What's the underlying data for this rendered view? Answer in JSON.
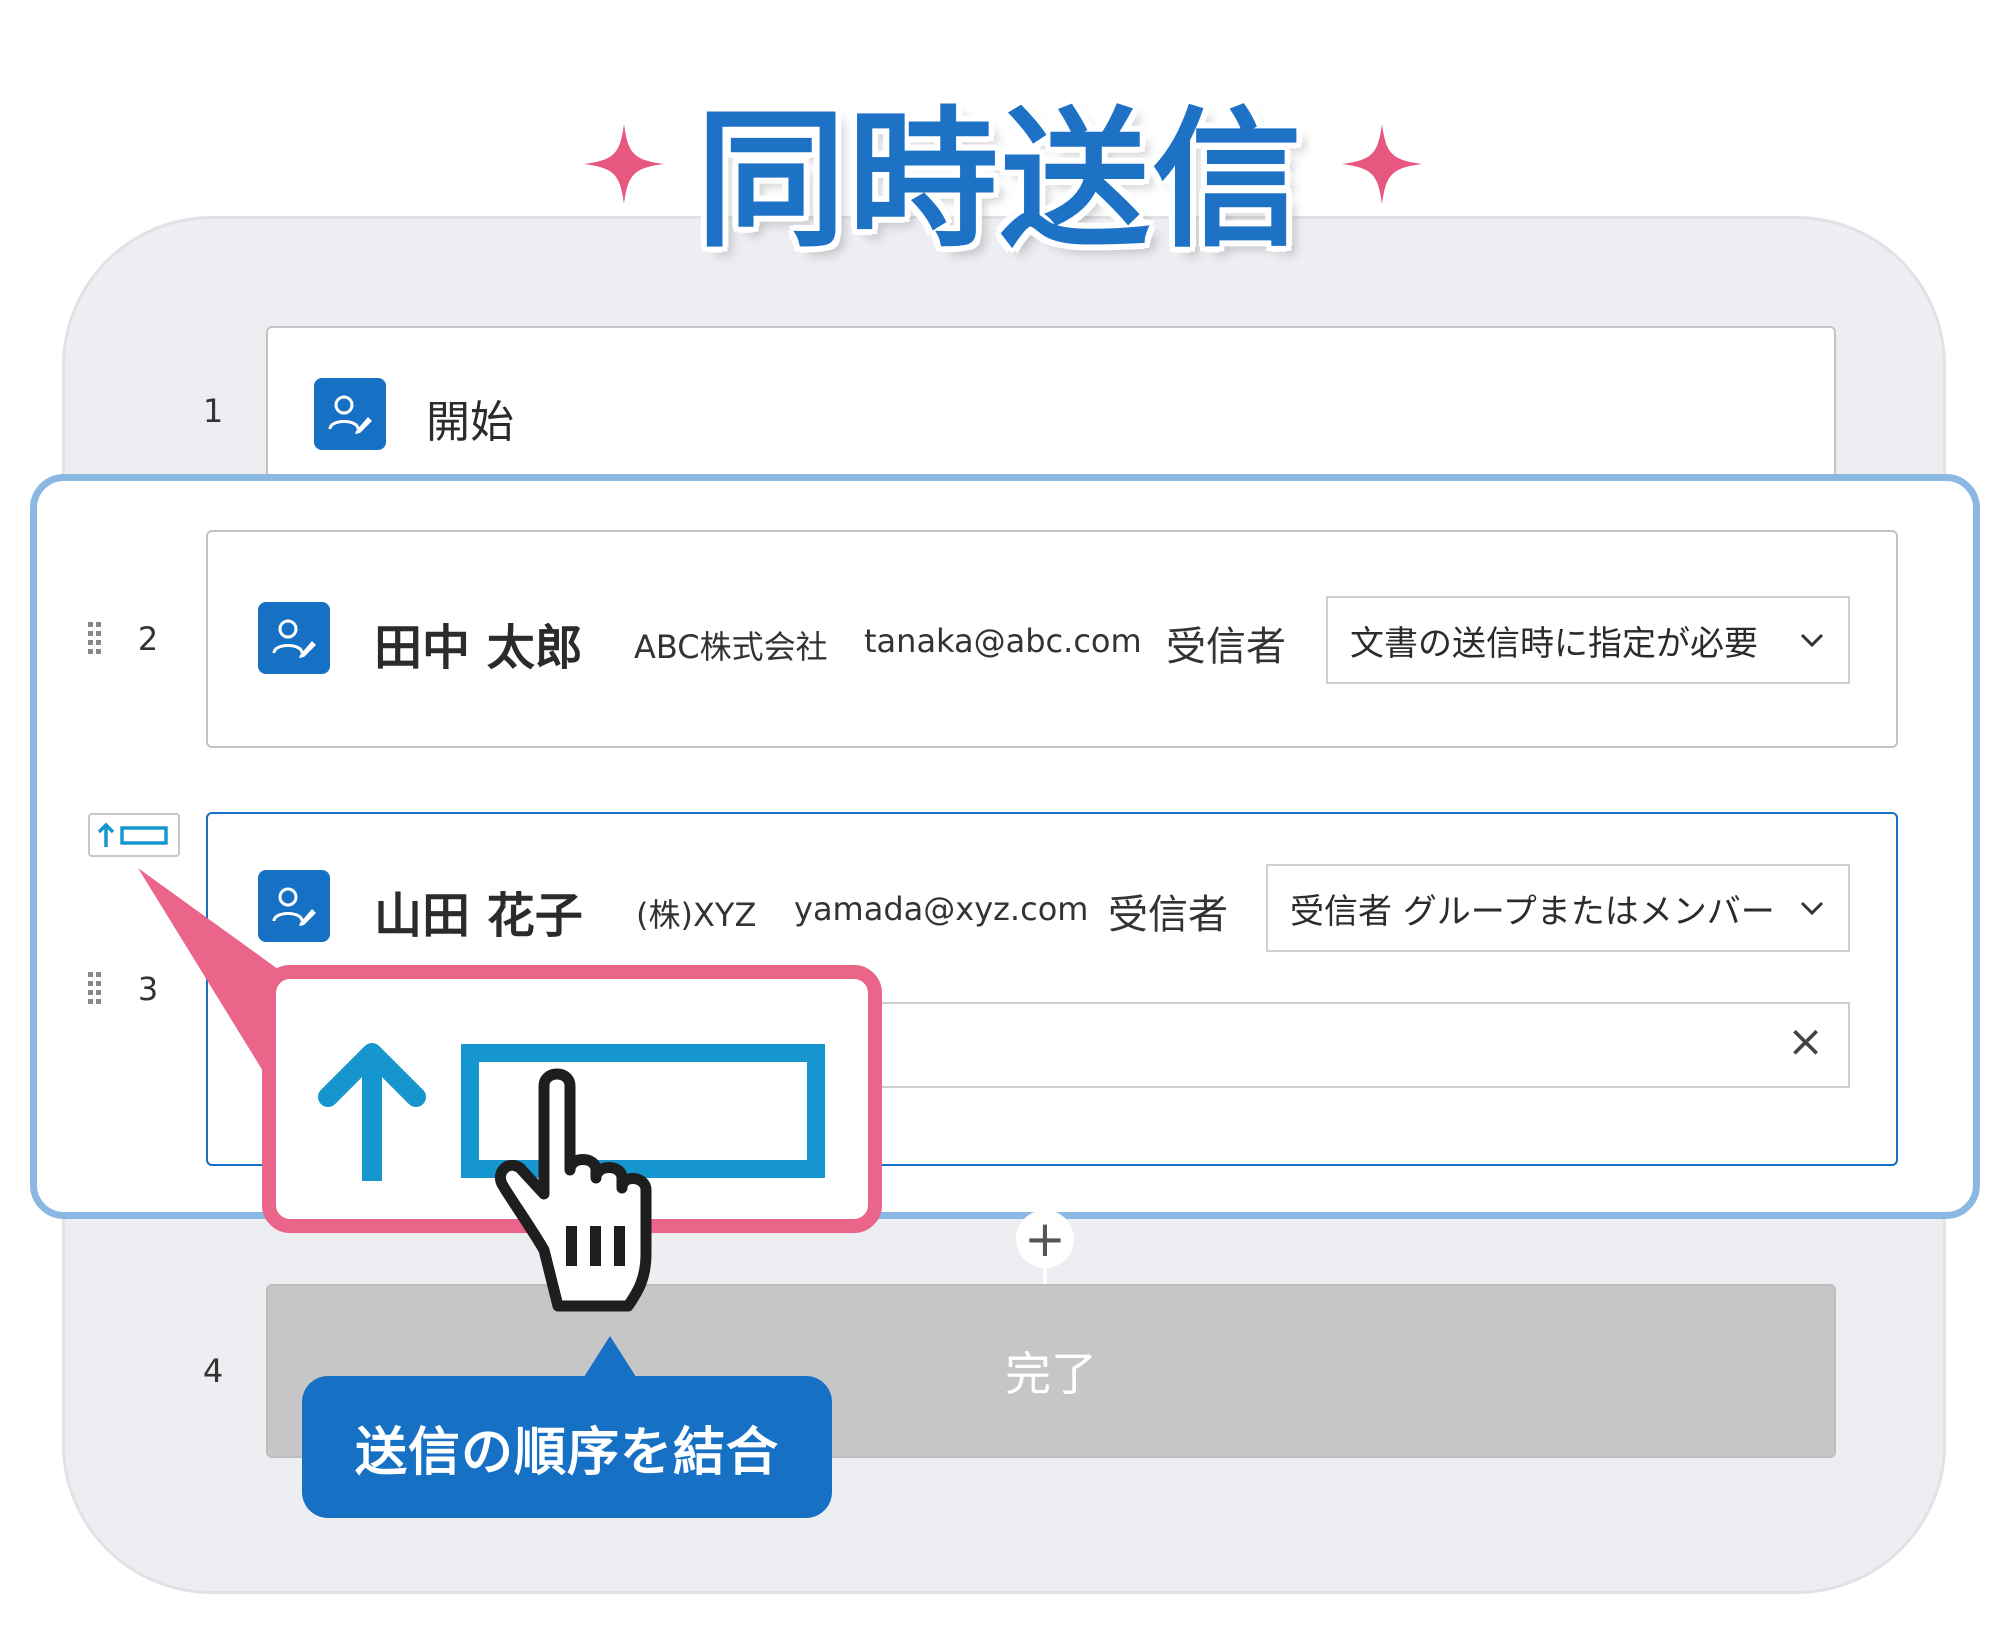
{
  "title": "同時送信",
  "steps": {
    "start": {
      "number": "1",
      "label": "開始"
    },
    "recipient1": {
      "number": "2",
      "name": "田中 太郎",
      "company": "ABC株式会社",
      "email": "tanaka@abc.com",
      "role": "受信者",
      "dropdown_value": "文書の送信時に指定が必要"
    },
    "recipient2": {
      "number": "3",
      "name": "山田 花子",
      "company": "(株)XYZ",
      "email": "yamada@xyz.com",
      "role": "受信者",
      "dropdown_value": "受信者 グループまたはメンバー",
      "clear_symbol": "×"
    },
    "add_symbol": "+",
    "end": {
      "number": "4",
      "label": "完了"
    }
  },
  "tooltip": "送信の順序を結合",
  "colors": {
    "accent_blue": "#1670c4",
    "callout_pink": "#ea6589",
    "sparkle_pink": "#e8577f",
    "highlight_border": "#8ab8e2",
    "merge_icon_blue": "#1596cf"
  }
}
